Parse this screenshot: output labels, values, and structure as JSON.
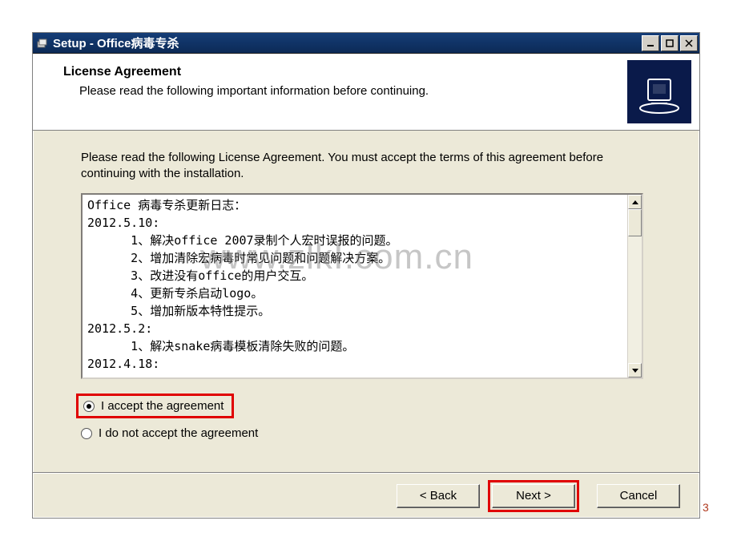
{
  "titlebar": {
    "text": "Setup - Office病毒专杀"
  },
  "header": {
    "title": "License Agreement",
    "subtitle": "Please read the following important information before continuing."
  },
  "body": {
    "intro": "Please read the following License Agreement. You must accept the terms of this agreement before continuing with the installation.",
    "license_text": "Office 病毒专杀更新日志：\n2012.5.10:\n      1、解决office 2007录制个人宏时误报的问题。\n      2、增加清除宏病毒时常见问题和问题解决方案。\n      3、改进没有office的用户交互。\n      4、更新专杀启动logo。\n      5、增加新版本特性提示。\n2012.5.2:\n      1、解决snake病毒模板清除失败的问题。\n2012.4.18:"
  },
  "radios": {
    "accept": "I accept the agreement",
    "reject": "I do not accept the agreement",
    "selected": "accept"
  },
  "footer": {
    "back": "< Back",
    "next": "Next >",
    "cancel": "Cancel"
  },
  "watermark": "www.zlkⅠ.com.cn",
  "corner": "3"
}
